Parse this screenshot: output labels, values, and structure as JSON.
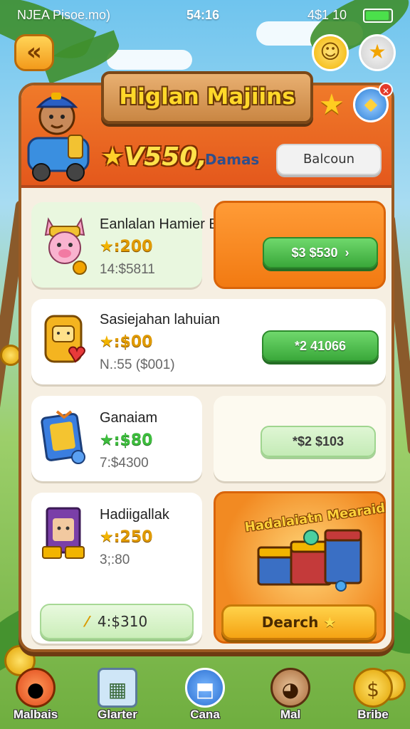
{
  "status_bar": {
    "carrier": "NJEA Pisoe.mo)",
    "time": "54:16",
    "signal": "4$1 10"
  },
  "header": {
    "title": "Higlan Majiins",
    "coins": "V550,",
    "currency_label": "Damas",
    "balance_button": "Balcoun"
  },
  "items": [
    {
      "name": "Eanlalan Hamier Bhavaka:",
      "price": "200",
      "sub": "14:$5811",
      "button": "$3 $530",
      "button_arrow": "›"
    },
    {
      "name": "Sasiejahan lahuian",
      "price": "$00",
      "sub": "N.:55 ($001)",
      "button": "2 41066"
    },
    {
      "name": "Ganaiam",
      "price": "$80",
      "sub": "7:$4300",
      "button": "$2 $103"
    },
    {
      "name": "Hadiigallak",
      "price": "250",
      "sub": "3;:80",
      "button": "4:$310"
    }
  ],
  "featured": {
    "title": "Hadalaiatn Mearaid",
    "button": "Dearch"
  },
  "nav": [
    {
      "label": "Malbais",
      "icon": "mango-icon"
    },
    {
      "label": "Glarter",
      "icon": "map-icon"
    },
    {
      "label": "Cana",
      "icon": "bookmark-icon"
    },
    {
      "label": "Mal",
      "icon": "pet-icon"
    },
    {
      "label": "Bribe",
      "icon": "coins-icon"
    }
  ],
  "colors": {
    "accent": "#e4581c",
    "panel": "#f6efe2",
    "green_button": "#3aa83a",
    "gold": "#ffd82a"
  }
}
